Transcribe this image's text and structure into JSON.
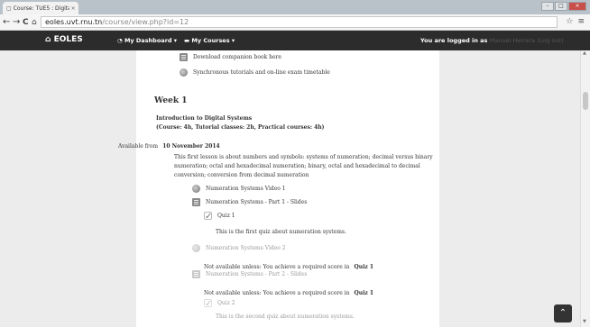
{
  "browser": {
    "tab_title": "Course: TUE5 : Digital ele...",
    "tab_close": "×",
    "url_host": "eoles.uvt.rnu.tn",
    "url_path": "/course/view.php?id=12",
    "back": "←",
    "forward": "→",
    "reload": "C",
    "home": "⌂",
    "menu": "≡",
    "star": "☆"
  },
  "navbar": {
    "brand": "EOLES",
    "dashboard": "My Dashboard",
    "courses": "My Courses",
    "logged_in_prefix": "You are logged in as",
    "user_name": "Manuel Herrera",
    "logout": "(Log out)"
  },
  "course": {
    "top_items": [
      {
        "label": "Download companion book here"
      },
      {
        "label": "Synchronous tutorials and on-line exam timetable"
      }
    ],
    "week_title": "Week 1",
    "week_subtitle": "Introduction to Digital Systems",
    "week_detail": "(Course: 4h, Tutorial classes: 2h, Practical courses: 4h)",
    "available_prefix": "Available from",
    "available_date": "10 November 2014",
    "intro": "This first lesson is about numbers and symbols: systems of numeration; decimal versus binary numeration; octal and hexadecimal numeration; binary, octal and hexadecimal to decimal conversion; conversion from decimal numeration",
    "activities": {
      "video1": "Numeration Systems Video 1",
      "slides1": "Numeration Systems - Part 1 - Slides",
      "quiz1": "Quiz 1",
      "quiz1_desc": "This is the first quiz about numeration systems.",
      "video2": "Numeration Systems Video 2",
      "restriction_prefix": "Not available unless: You achieve a required score in",
      "restriction_quiz": "Quiz 1",
      "slides2": "Numeration Systems - Part 2 - Slides",
      "quiz2": "Quiz 2",
      "quiz2_desc": "This is the second quiz about numeration systems."
    }
  },
  "back_to_top": "⌃"
}
